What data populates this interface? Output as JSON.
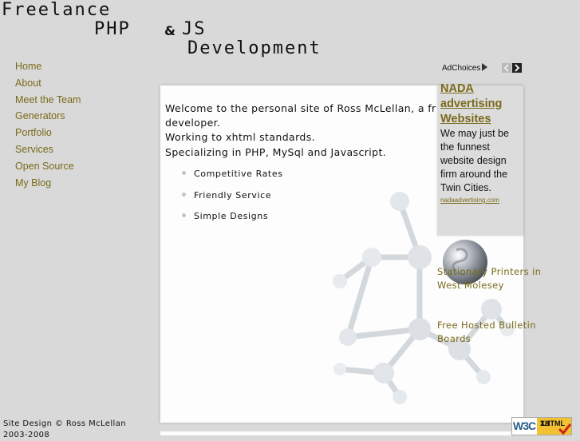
{
  "header": {
    "logo_line1": "Freelance",
    "logo_line2": "PHP",
    "logo_amp": "&",
    "logo_line3": "JS",
    "logo_line4": "Development"
  },
  "nav": {
    "items": [
      "Home",
      "About",
      "Meet the Team",
      "Generators",
      "Portfolio",
      "Services",
      "Open Source",
      "My Blog"
    ]
  },
  "main": {
    "intro_line1": "Welcome to the personal site of Ross McLellan, a fr",
    "intro_line2": "developer.",
    "intro_line3": "Working to xhtml standards.",
    "intro_line4": "Specializing in PHP, MySql and Javascript.",
    "features": [
      "Competitive Rates",
      "Friendly Service",
      "Simple Designs"
    ]
  },
  "ads": {
    "adchoices_label": "AdChoices",
    "title": "NADA advertising Websites",
    "body": "We may just be the funnest website design firm around the Twin Cities.",
    "url": "nadaadvertising.com",
    "link1": "Stationary Printers in West Molesey",
    "link2": "Free Hosted Bulletin Boards"
  },
  "footer": {
    "copyright": "Site Design © Ross McLellan",
    "years": "2003-2008"
  },
  "badge": {
    "w3c": "W3C",
    "xhtml": "XHTML",
    "version": "1.1"
  },
  "colors": {
    "page_bg": "#d9d9d9",
    "link": "#7a6a1a",
    "panel": "#fdfdfd"
  }
}
